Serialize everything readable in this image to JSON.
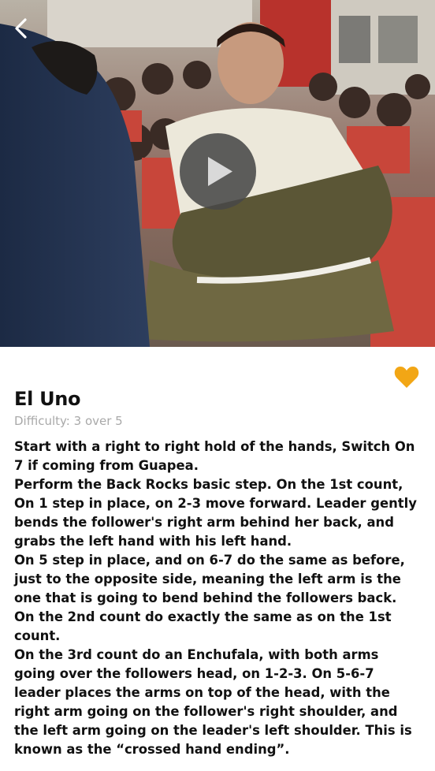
{
  "header": {
    "back_icon": "chevron-left-icon",
    "play_icon": "play-icon"
  },
  "figure": {
    "title": "El Uno",
    "difficulty": "Difficulty: 3 over 5",
    "favorite_icon": "heart-icon",
    "favorite_color": "#F2A615"
  },
  "description": {
    "paragraphs": [
      "Start with a right to right hold of the hands, Switch On 7 if coming from Guapea.",
      "Perform the Back Rocks basic step. On the 1st count, On 1 step in place, on 2-3 move forward. Leader gently bends the follower's right arm behind her back, and grabs the left hand with his left hand.",
      "On 5 step in place, and on 6-7 do the same as before, just to the opposite side, meaning the left arm is the one that is going to bend behind the followers back.",
      "On the 2nd count do exactly the same as on the 1st count.",
      "On the 3rd count do an Enchufala, with both arms going over the followers head, on 1-2-3. On 5-6-7 leader places the arms on top of the head, with the right arm going on the follower's right shoulder, and the left arm going on the leader's left shoulder. This is known as the “crossed hand ending”."
    ]
  }
}
